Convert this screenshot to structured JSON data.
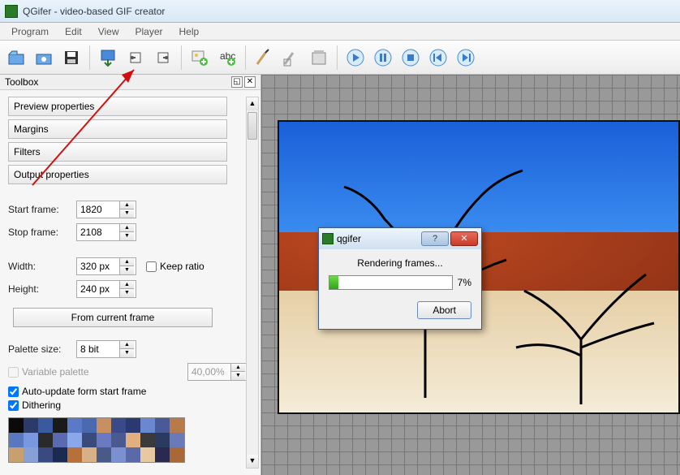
{
  "window": {
    "title": "QGifer - video-based GIF creator"
  },
  "menu": {
    "program": "Program",
    "edit": "Edit",
    "view": "View",
    "player": "Player",
    "help": "Help"
  },
  "toolbox": {
    "title": "Toolbox",
    "sections": {
      "preview": "Preview properties",
      "margins": "Margins",
      "filters": "Filters",
      "output": "Output properties"
    },
    "start_frame_label": "Start frame:",
    "start_frame_value": "1820",
    "stop_frame_label": "Stop frame:",
    "stop_frame_value": "2108",
    "width_label": "Width:",
    "width_value": "320 px",
    "height_label": "Height:",
    "height_value": "240 px",
    "keep_ratio_label": "Keep ratio",
    "from_current_label": "From current frame",
    "palette_size_label": "Palette size:",
    "palette_size_value": "8 bit",
    "variable_palette_label": "Variable palette",
    "variable_palette_pct": "40,00%",
    "auto_update_label": "Auto-update form start frame",
    "dithering_label": "Dithering"
  },
  "dialog": {
    "title": "qgifer",
    "status": "Rendering frames...",
    "percent": "7%",
    "percent_val": 7,
    "abort": "Abort"
  },
  "palette_colors": [
    "#0a0a0a",
    "#2a3a6a",
    "#3a5aa0",
    "#1a1a1a",
    "#5a7ac8",
    "#4a6ab0",
    "#c89060",
    "#3a4a88",
    "#2a3a70",
    "#6a88d0",
    "#4a5a98",
    "#b87a4a",
    "#5a78c0",
    "#7a98e0",
    "#2a2a2a",
    "#5a6ab0",
    "#88a8e8",
    "#3a4a7a",
    "#6a7ac0",
    "#4a5a90",
    "#e0b080",
    "#3a3a3a",
    "#2a3a60",
    "#6a7ab8",
    "#c8a070",
    "#88a0d8",
    "#3a4a80",
    "#1a2a50",
    "#b8703a",
    "#d8b088",
    "#4a5a88",
    "#7a90d0",
    "#5a6aa8",
    "#e8c8a0",
    "#2a2a50",
    "#a86838"
  ]
}
